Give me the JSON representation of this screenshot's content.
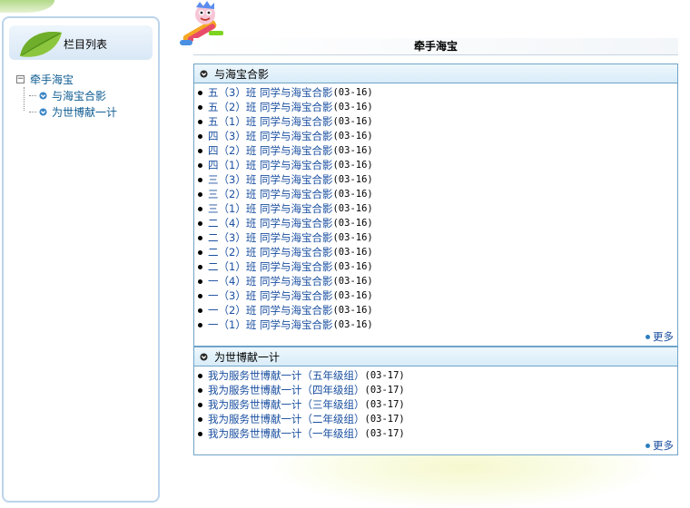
{
  "sidebar": {
    "title": "栏目列表",
    "tree": {
      "root_label": "牵手海宝",
      "toggle": "−",
      "children": [
        {
          "label": "与海宝合影"
        },
        {
          "label": "为世博献一计"
        }
      ]
    }
  },
  "main": {
    "title": "牵手海宝",
    "panels": [
      {
        "title": "与海宝合影",
        "more_label": "更多",
        "items": [
          {
            "text": "五（3）班 同学与海宝合影",
            "date": "(03-16)"
          },
          {
            "text": "五（2）班 同学与海宝合影",
            "date": "(03-16)"
          },
          {
            "text": "五（1）班 同学与海宝合影",
            "date": "(03-16)"
          },
          {
            "text": "四（3）班 同学与海宝合影",
            "date": "(03-16)"
          },
          {
            "text": "四（2）班 同学与海宝合影",
            "date": "(03-16)"
          },
          {
            "text": "四（1）班 同学与海宝合影",
            "date": "(03-16)"
          },
          {
            "text": "三（3）班 同学与海宝合影",
            "date": "(03-16)"
          },
          {
            "text": "三（2）班 同学与海宝合影",
            "date": "(03-16)"
          },
          {
            "text": "三（1）班 同学与海宝合影",
            "date": "(03-16)"
          },
          {
            "text": "二（4）班 同学与海宝合影",
            "date": "(03-16)"
          },
          {
            "text": "二（3）班 同学与海宝合影",
            "date": "(03-16)"
          },
          {
            "text": "二（2）班 同学与海宝合影",
            "date": "(03-16)"
          },
          {
            "text": "二（1）班 同学与海宝合影",
            "date": "(03-16)"
          },
          {
            "text": "一（4）班 同学与海宝合影",
            "date": "(03-16)"
          },
          {
            "text": "一（3）班 同学与海宝合影",
            "date": "(03-16)"
          },
          {
            "text": "一（2）班 同学与海宝合影",
            "date": "(03-16)"
          },
          {
            "text": "一（1）班 同学与海宝合影",
            "date": "(03-16)"
          }
        ]
      },
      {
        "title": "为世博献一计",
        "more_label": "更多",
        "items": [
          {
            "text": "我为服务世博献一计（五年级组）",
            "date": "(03-17)"
          },
          {
            "text": "我为服务世博献一计（四年级组）",
            "date": "(03-17)"
          },
          {
            "text": "我为服务世博献一计（三年级组）",
            "date": "(03-17)"
          },
          {
            "text": "我为服务世博献一计（二年级组）",
            "date": "(03-17)"
          },
          {
            "text": "我为服务世博献一计（一年级组）",
            "date": "(03-17)"
          }
        ]
      }
    ]
  },
  "colors": {
    "link": "#1a4fa0",
    "tree_link": "#0e5c92",
    "panel_border": "#6fa4c8",
    "sidebar_border": "#bcd4ec"
  },
  "icons": [
    "leaf-icon",
    "mascot-icon",
    "circle-chevron-icon",
    "tree-toggle-icon",
    "more-dot-icon"
  ]
}
